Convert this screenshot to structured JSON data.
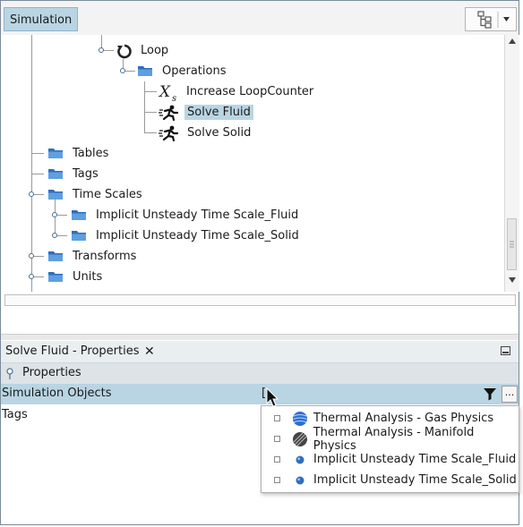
{
  "topbar": {
    "tab_label": "Simulation"
  },
  "tree": {
    "items": [
      {
        "label": "Loop",
        "icon": "loop-icon"
      },
      {
        "label": "Operations",
        "icon": "folder-icon"
      },
      {
        "label": "Increase LoopCounter",
        "icon": "xs-variable-icon"
      },
      {
        "label": "Solve Fluid",
        "icon": "runner-icon",
        "selected": true
      },
      {
        "label": "Solve Solid",
        "icon": "runner-icon"
      },
      {
        "label": "Tables",
        "icon": "folder-icon"
      },
      {
        "label": "Tags",
        "icon": "folder-icon"
      },
      {
        "label": "Time Scales",
        "icon": "folder-icon"
      },
      {
        "label": "Implicit Unsteady Time Scale_Fluid",
        "icon": "folder-icon"
      },
      {
        "label": "Implicit Unsteady Time Scale_Solid",
        "icon": "folder-icon"
      },
      {
        "label": "Transforms",
        "icon": "folder-icon"
      },
      {
        "label": "Units",
        "icon": "folder-icon"
      }
    ]
  },
  "properties": {
    "tab_title": "Solve Fluid - Properties",
    "close_glyph": "✕",
    "section": "Properties",
    "rows": [
      {
        "label": "Simulation Objects",
        "value": "["
      },
      {
        "label": "Tags",
        "value": ""
      }
    ]
  },
  "dropdown": {
    "items": [
      {
        "label": "Thermal Analysis - Gas Physics",
        "icon": "physics-sphere-icon"
      },
      {
        "label": "Thermal Analysis - Manifold Physics",
        "icon": "hatched-sphere-icon"
      },
      {
        "label": "Implicit Unsteady Time Scale_Fluid",
        "icon": "blue-dot-icon"
      },
      {
        "label": "Implicit Unsteady Time Scale_Solid",
        "icon": "blue-dot-icon"
      }
    ]
  },
  "colors": {
    "selection": "#b9d5e3",
    "folder": "#2f6fbf"
  }
}
